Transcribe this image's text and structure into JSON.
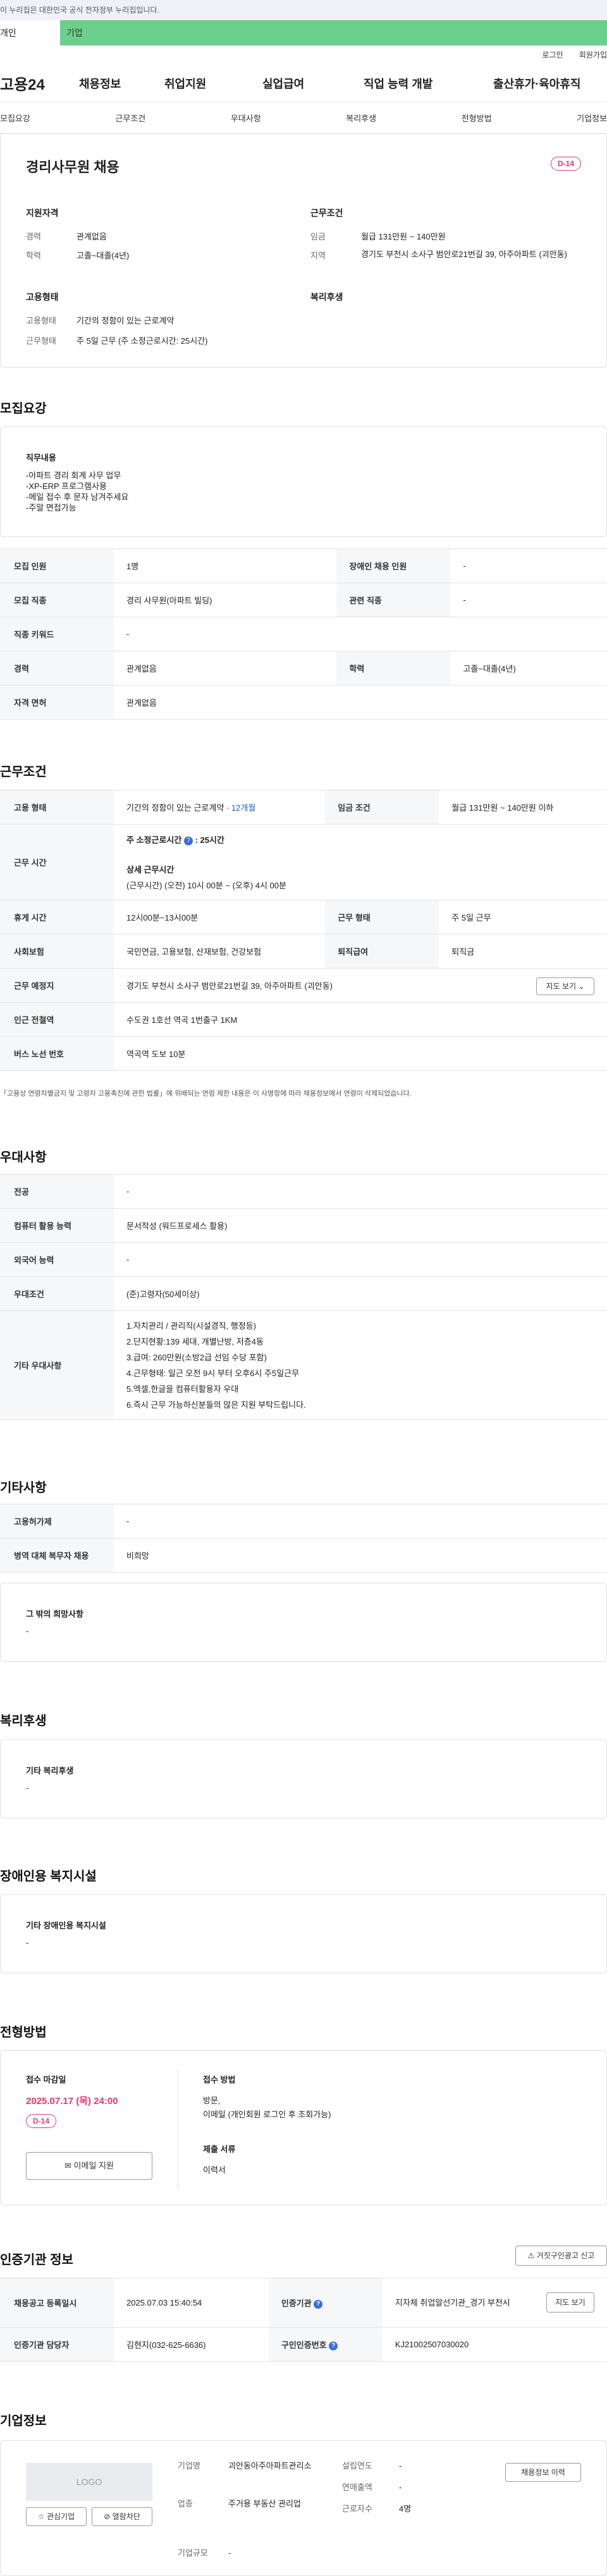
{
  "gov_banner": "이 누리집은 대한민국 공식 전자정부 누리집입니다.",
  "top_tabs": {
    "personal": "개인",
    "company": "기업"
  },
  "util": {
    "login": "로그인",
    "join": "회원가입"
  },
  "gnb": {
    "logo": "고용24",
    "menu": [
      "채용정보",
      "취업지원",
      "실업급여",
      "직업 능력 개발",
      "출산휴가·육아휴직"
    ]
  },
  "subnav": [
    "모집요강",
    "근무조건",
    "우대사항",
    "복리후생",
    "전형방법",
    "기업정보"
  ],
  "summary": {
    "title": "경리사무원 채용",
    "dday": "D-14",
    "qual_title": "지원자격",
    "qual": [
      {
        "label": "경력",
        "value": "관계없음"
      },
      {
        "label": "학력",
        "value": "고졸~대졸(4년)"
      }
    ],
    "cond_title": "근무조건",
    "cond": [
      {
        "label": "임금",
        "value": "월급 131만원 ~ 140만원"
      },
      {
        "label": "지역",
        "value": "경기도 부천시 소사구 범안로21번길 39, 아주아파트 (괴안동)"
      }
    ],
    "emp_title": "고용형태",
    "emp": [
      {
        "label": "고용형태",
        "value": "기간의 정함이 있는 근로계약"
      },
      {
        "label": "근무형태",
        "value": "주 5일 근무 (주 소정근로시간: 25시간)"
      }
    ],
    "welfare_title": "복리후생"
  },
  "recruit": {
    "heading": "모집요강",
    "duty_title": "직무내용",
    "duty_lines": [
      "-아파트  경리 회계 사무 업무",
      "-XP-ERP 프로그램사용",
      "-메일 접수 후 문자 남겨주세요",
      "-주말 면접가능"
    ],
    "rows": [
      {
        "l1": "모집 인원",
        "v1": "1명",
        "l2": "장애인 채용 인원",
        "v2": "-"
      },
      {
        "l1": "모집 직종",
        "v1": "경리 사무원(아파트 빌딩)",
        "l2": "관련 직종",
        "v2": "-"
      },
      {
        "l1": "직종 키워드",
        "v1": "-"
      },
      {
        "l1": "경력",
        "v1": "관계없음",
        "l2": "학력",
        "v2": "고졸~대졸(4년)"
      },
      {
        "l1": "자격 면허",
        "v1": "관계없음"
      }
    ]
  },
  "work": {
    "heading": "근무조건",
    "emp_label": "고용 형태",
    "emp_value": "기간의 정함이 있는 근로계약 · ",
    "emp_period": "12개월",
    "wage_label": "임금 조건",
    "wage_value": "월급 131만원 ~ 140만원 이하",
    "time_label": "근무 시간",
    "time_week": "주 소정근로시간",
    "time_week_val": ": 25시간",
    "time_detail_title": "상세 근무시간",
    "time_detail": "(근무시간) (오전) 10시 00분 ~ (오후) 4시 00분",
    "rest_label": "휴게 시간",
    "rest_value": "12시00분~13시00분",
    "form_label": "근무 형태",
    "form_value": "주 5일 근무",
    "ins_label": "사회보험",
    "ins_value": "국민연금, 고용보험, 산재보험, 건강보험",
    "sev_label": "퇴직급여",
    "sev_value": "퇴직금",
    "place_label": "근무 예정지",
    "place_value": "경기도 부천시 소사구 범안로21번길 39, 아주아파트 (괴안동)",
    "map_btn": "지도 보기",
    "subway_label": "인근 전철역",
    "subway_value": "수도권 1호선 역곡 1번출구 1KM",
    "bus_label": "버스 노선 번호",
    "bus_value": "역곡역 도보 10분",
    "note": "「고용상 연령차별금지 및 고령자 고용촉진에 관한 법률」에 위배되는 연령 제한 내용은 이 사명항에 따라 채용정보에서 연령이 삭제되었습니다."
  },
  "pref": {
    "heading": "우대사항",
    "rows": [
      {
        "label": "전공",
        "value": "-"
      },
      {
        "label": "컴퓨터 활용 능력",
        "value": "문서작성 (워드프로세스 활용)"
      },
      {
        "label": "외국어 능력",
        "value": "-"
      },
      {
        "label": "우대조건",
        "value": "(준)고령자(50세이상)"
      }
    ],
    "etc_label": "기타 우대사항",
    "etc_lines": [
      "1.자치관리 / 관리직(시설경직, 행정등)",
      "2.단지현황:139 세대, 개별난방, 저층4동",
      "3.급여: 260만원(소방2급 선임 수당 포함)",
      "4.근무형태: 일근 오전 9시 부터 오후6시 주5일근무",
      "5.엑셀,한글을 컴퓨터활용자 우대",
      "6.즉시 근무 가능하신분들의 많은 지원 부탁드립니다."
    ]
  },
  "other": {
    "heading": "기타사항",
    "rows": [
      {
        "label": "고용허가제",
        "value": "-"
      },
      {
        "label": "병역 대체 복무자 채용",
        "value": "비희망"
      }
    ],
    "wish_title": "그 밖의 희망사항",
    "wish_value": "-"
  },
  "welfare": {
    "heading": "복리후생",
    "title": "기타 복리후생",
    "value": "-"
  },
  "disabled": {
    "heading": "장애인용 복지시설",
    "title": "기타 장애인용 복지시설",
    "value": "-"
  },
  "process": {
    "heading": "전형방법",
    "deadline_title": "접수 마감일",
    "deadline": "2025.07.17 (목) 24:00",
    "dday": "D-14",
    "email_btn": "이메일 지원",
    "method_title": "접수 방법",
    "method_lines": [
      "방문,",
      "이메일 (개인회원 로그인 후 조회가능)"
    ],
    "docs_title": "제출 서류",
    "docs_value": "이력서"
  },
  "cert": {
    "heading": "인증기관 정보",
    "report_btn": "거짓구인광고 신고",
    "reg_label": "채용공고 등록일시",
    "reg_value": "2025.07.03 15:40:54",
    "org_label": "인증기관",
    "org_value": "지자체 취업알선기관_경기 부천시",
    "map_btn": "지도 보기",
    "staff_label": "인증기관 담당자",
    "staff_value": "김현지(032-625-6636)",
    "no_label": "구인인증번호",
    "no_value": "KJ21002507030020"
  },
  "company": {
    "heading": "기업정보",
    "logo": "LOGO",
    "fav_btn": "관심기업",
    "block_btn": "열람차단",
    "info_btn": "채용정보 이력",
    "name_label": "기업명",
    "name_value": "괴안동아주아파트관리소",
    "year_label": "설립연도",
    "year_value": "-",
    "sales_label": "연매출액",
    "sales_value": "-",
    "ind_label": "업종",
    "ind_value": "주거용 부동산 관리업",
    "emp_label": "근로자수",
    "emp_value": "4명",
    "size_label": "기업규모",
    "size_value": "-"
  }
}
